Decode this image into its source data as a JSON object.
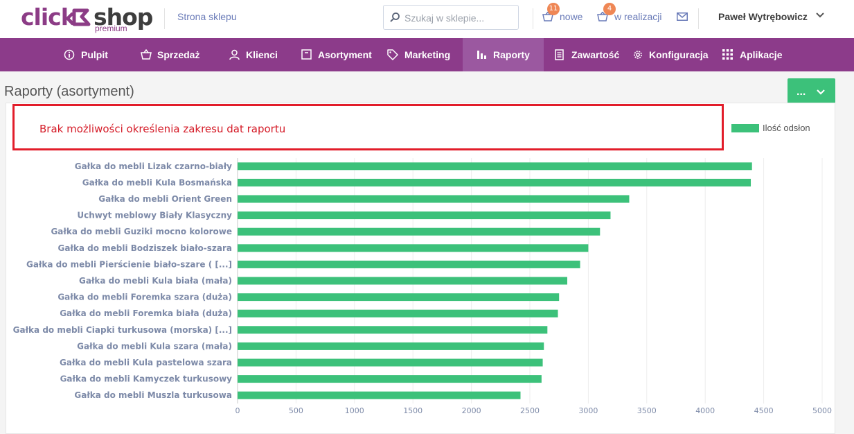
{
  "header": {
    "logo": {
      "click": "click",
      "shop": "shop",
      "premium": "premium"
    },
    "store_link": "Strona sklepu",
    "search": {
      "placeholder": "Szukaj w sklepie..."
    },
    "orders_new": {
      "badge": "11",
      "label": "nowe"
    },
    "orders_in_progress": {
      "badge": "4",
      "label": "w realizacji"
    },
    "user_name": "Paweł Wytrębowicz"
  },
  "nav": {
    "items": [
      {
        "label": "Pulpit",
        "icon": "info-icon"
      },
      {
        "label": "Sprzedaż",
        "icon": "basket-icon"
      },
      {
        "label": "Klienci",
        "icon": "user-icon"
      },
      {
        "label": "Asortyment",
        "icon": "box-icon"
      },
      {
        "label": "Marketing",
        "icon": "tag-icon"
      },
      {
        "label": "Raporty",
        "icon": "bar-chart-icon",
        "active": true
      },
      {
        "label": "Zawartość",
        "icon": "document-icon"
      },
      {
        "label": "Konfiguracja",
        "icon": "gear-icon"
      },
      {
        "label": "Aplikacje",
        "icon": "grid-icon"
      }
    ]
  },
  "page": {
    "title": "Raporty (asortyment)",
    "menu_button": "..."
  },
  "annotation": {
    "text": "Brak możliwości określenia zakresu dat raportu",
    "color": "#e21d2a"
  },
  "colors": {
    "brand_purple": "#8c3b8a",
    "accent_green": "#3cc17a",
    "badge_orange": "#ef8755"
  },
  "chart_data": {
    "type": "bar",
    "orientation": "horizontal",
    "title": "",
    "xlabel": "",
    "ylabel": "",
    "legend": {
      "position": "top-right"
    },
    "xlim": [
      0,
      5000
    ],
    "xticks": [
      0,
      500,
      1000,
      1500,
      2000,
      2500,
      3000,
      3500,
      4000,
      4500,
      5000
    ],
    "grid": true,
    "categories": [
      "Gałka do mebli Lizak czarno-biały",
      "Gałka do mebli Kula Bosmańska",
      "Gałka do mebli Orient Green",
      "Uchwyt meblowy Biały Klasyczny",
      "Gałka do mebli Guziki mocno kolorowe",
      "Gałka do mebli Bodziszek biało-szara",
      "Gałka do mebli Pierścienie biało-szare ( [...]",
      "Gałka do mebli Kula biała (mała)",
      "Gałka do mebli Foremka szara (duża)",
      "Gałka do mebli Foremka biała (duża)",
      "Gałka do mebli Ciapki turkusowa (morska) [...]",
      "Gałka do mebli Kula szara (mała)",
      "Gałka do mebli Kula pastelowa szara",
      "Gałka do mebli Kamyczek turkusowy",
      "Gałka do mebli Muszla turkusowa"
    ],
    "series": [
      {
        "name": "Ilość odsłon",
        "color": "#3cc17a",
        "values": [
          4400,
          4390,
          3350,
          3190,
          3100,
          3000,
          2930,
          2820,
          2750,
          2740,
          2650,
          2620,
          2610,
          2600,
          2420
        ]
      }
    ]
  }
}
